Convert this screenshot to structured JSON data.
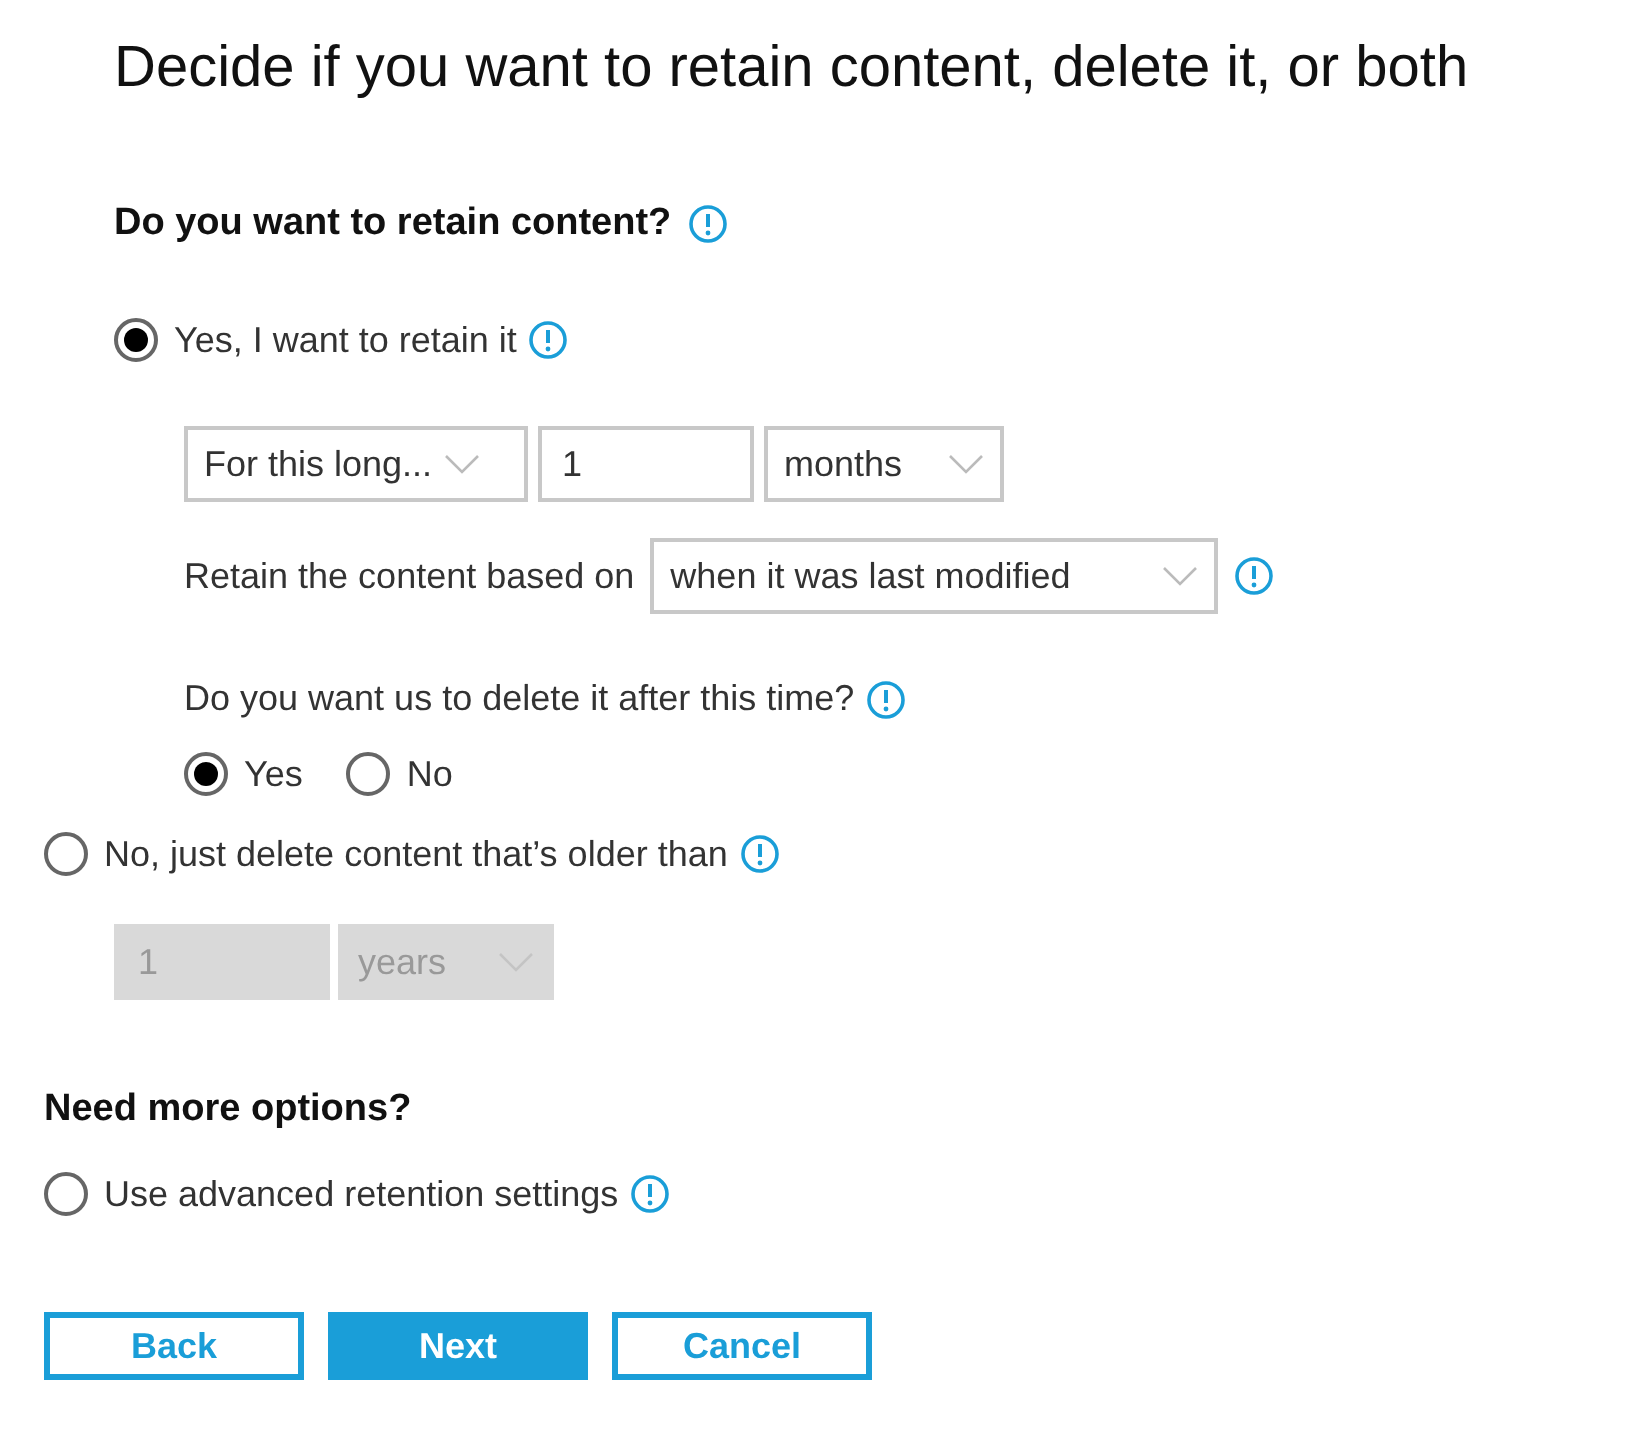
{
  "title": "Decide if you want to retain content, delete it, or both",
  "retain_question": "Do you want to retain content?",
  "retain_option": {
    "label": "Yes, I want to retain it",
    "selected": true
  },
  "retain_settings": {
    "duration": "For this long...",
    "amount": "1",
    "unit": "months",
    "based_on_label": "Retain the content based on",
    "based_on": "when it was last modified",
    "delete_question": "Do you want us to delete it after this time?",
    "delete_choices": [
      {
        "label": "Yes",
        "selected": true
      },
      {
        "label": "No",
        "selected": false
      }
    ]
  },
  "delete_option": {
    "label": "No, just delete content that’s older than",
    "selected": false
  },
  "delete_settings": {
    "amount": "1",
    "unit": "years",
    "disabled": true
  },
  "more_heading": "Need more options?",
  "advanced_option": {
    "label": "Use advanced retention settings",
    "selected": false
  },
  "buttons": [
    {
      "label": "Back",
      "primary": false
    },
    {
      "label": "Next",
      "primary": true
    },
    {
      "label": "Cancel",
      "primary": false
    }
  ]
}
